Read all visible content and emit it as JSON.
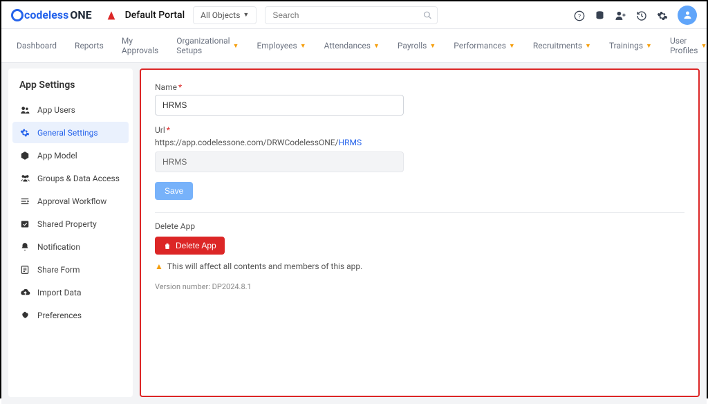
{
  "header": {
    "logo_text_1": "codeless",
    "logo_text_2": "ONE",
    "portal_label": "Default Portal",
    "object_selector": "All Objects",
    "search_placeholder": "Search"
  },
  "nav": {
    "items": [
      {
        "label": "Dashboard",
        "has_caret": false
      },
      {
        "label": "Reports",
        "has_caret": false
      },
      {
        "label": "My Approvals",
        "has_caret": false
      },
      {
        "label": "Organizational Setups",
        "has_caret": true
      },
      {
        "label": "Employees",
        "has_caret": true
      },
      {
        "label": "Attendances",
        "has_caret": true
      },
      {
        "label": "Payrolls",
        "has_caret": true
      },
      {
        "label": "Performances",
        "has_caret": true
      },
      {
        "label": "Recruitments",
        "has_caret": true
      },
      {
        "label": "Trainings",
        "has_caret": true
      },
      {
        "label": "User Profiles",
        "has_caret": true
      }
    ]
  },
  "sidebar": {
    "title": "App Settings",
    "items": [
      {
        "label": "App Users"
      },
      {
        "label": "General Settings"
      },
      {
        "label": "App Model"
      },
      {
        "label": "Groups & Data Access"
      },
      {
        "label": "Approval Workflow"
      },
      {
        "label": "Shared Property"
      },
      {
        "label": "Notification"
      },
      {
        "label": "Share Form"
      },
      {
        "label": "Import Data"
      },
      {
        "label": "Preferences"
      }
    ]
  },
  "form": {
    "name_label": "Name",
    "name_value": "HRMS",
    "url_label": "Url",
    "url_prefix": "https://app.codelessone.com/DRWCodelessONE/",
    "url_slug": "HRMS",
    "url_value": "HRMS",
    "save_label": "Save",
    "delete_heading": "Delete App",
    "delete_label": "Delete App",
    "delete_warning": "This will affect all contents and members of this app.",
    "version_label": "Version number: DP2024.8.1"
  }
}
